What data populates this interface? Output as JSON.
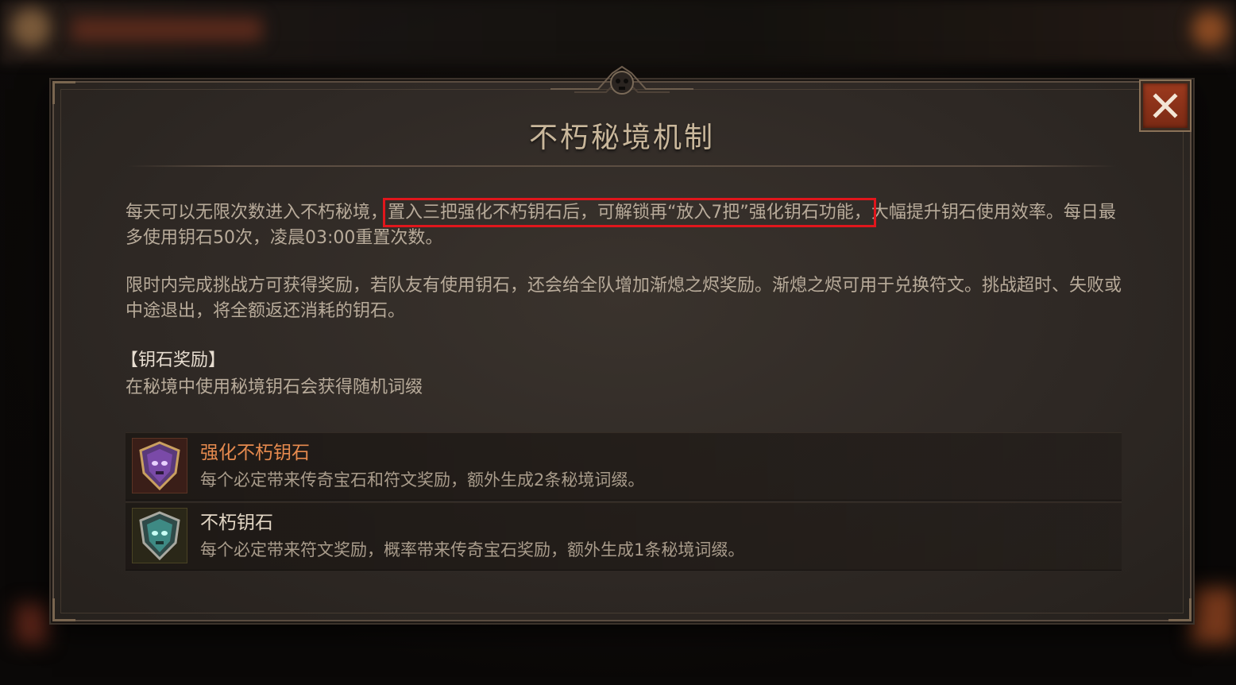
{
  "dialog": {
    "title": "不朽秘境机制",
    "close_icon": "close-icon"
  },
  "paragraph1": {
    "before": "每天可以无限次数进入不朽秘境，",
    "highlight": "置入三把强化不朽钥石后，可解锁再“放入7把”强化钥石功能，",
    "after": "大幅提升钥石使用效率。每日最多使用钥石50次，凌晨03:00重置次数。"
  },
  "paragraph2": "限时内完成挑战方可获得奖励，若队友有使用钥石，还会给全队增加渐熄之烬奖励。渐熄之烬可用于兑换符文。挑战超时、失败或中途退出，将全额返还消耗的钥石。",
  "section": {
    "title": "【钥石奖励】",
    "description": "在秘境中使用秘境钥石会获得随机词缀"
  },
  "rewards": [
    {
      "name": "强化不朽钥石",
      "description": "每个必定带来传奇宝石和符文奖励，额外生成2条秘境词缀。",
      "icon": "purple-keystone-icon",
      "color": "#e68a4e"
    },
    {
      "name": "不朽钥石",
      "description": "每个必定带来符文奖励，概率带来传奇宝石奖励，额外生成1条秘境词缀。",
      "icon": "teal-keystone-icon",
      "color": "#e2d6c4"
    }
  ],
  "colors": {
    "highlight_outline": "#e0161c",
    "close_button": "#9c3a1e",
    "title": "#c9b79b"
  }
}
